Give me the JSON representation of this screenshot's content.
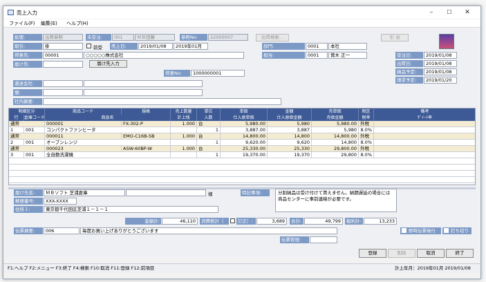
{
  "window": {
    "title": "売上入力",
    "minimize": "–",
    "maximize": "☐",
    "close": "✕"
  },
  "menu": [
    "ファイル(F)",
    "編集(E)",
    "ヘルプ(H)"
  ],
  "header": {
    "shori_label": "処理:",
    "shori_value": "出荷参照",
    "juchu_label": "未受注:",
    "juchu_code": "001",
    "juchu_name": "ＭＢ田藤",
    "sansho_label": "参照No:",
    "sansho_value": "22000007",
    "sansho_btn": "出荷検索...",
    "hikiate_btn": "引 当",
    "torihiki_label": "取引:",
    "torihiki_value": "掛",
    "zenuke_label": "前受",
    "uriage_label": "売上日:",
    "uriage_date": "2019/01/08",
    "uriage_month": "2019年01月",
    "bumon_label": "部門:",
    "bumon_code": "0001",
    "bumon_name": "本社",
    "tokui_label": "得意先:",
    "tokui_code": "00001",
    "tokui_name": "○○○○○株式会社",
    "tanto_label": "担当:",
    "tanto_code": "0001",
    "tanto_name": "賞木 正一",
    "todoke_label": "届け先:",
    "todoke_btn": "届け先入力",
    "denpyo_label": "得意No:",
    "denpyo_value": "1000000001",
    "unso_label": "運送会社:",
    "bin_label": "便:",
    "shanai_label": "社内摘要:",
    "dates": [
      {
        "label": "受注日:",
        "value": "2019/01/08"
      },
      {
        "label": "出荷日:",
        "value": "2019/01/08"
      },
      {
        "label": "納品予定:",
        "value": "2019/01/08"
      },
      {
        "label": "請求予定:",
        "value": "2019/01/20"
      }
    ]
  },
  "grid": {
    "head1": [
      "明細区分",
      "商品コード",
      "規格",
      "売上数量",
      "単位",
      "単価",
      "金額",
      "売単価",
      "税区",
      "備考"
    ],
    "head2": [
      "行",
      "倉庫コード",
      "商品名",
      "計上残",
      "入数",
      "仕入原単価",
      "仕入原価金額",
      "売価金額",
      "税率",
      "ｻﾞｲｰﾄ率"
    ],
    "rows": [
      {
        "a": [
          "通常",
          "000001",
          "FX-302-P",
          "1.000",
          "台",
          "5,980.00",
          "5,980",
          "5,980.00",
          "外税",
          ""
        ],
        "b": [
          "1",
          "001",
          "コンパクトファンヒータ",
          "",
          "1",
          "3,887.00",
          "3,887",
          "5,980",
          "8.0%",
          ""
        ]
      },
      {
        "a": [
          "通常",
          "000011",
          "EMO-C16B-SB",
          "1.000",
          "台",
          "14,800.00",
          "14,800",
          "14,800.00",
          "外税",
          ""
        ],
        "b": [
          "2",
          "001",
          "オーブンレンジ",
          "",
          "1",
          "9,620.00",
          "9,620",
          "14,800",
          "8.0%",
          ""
        ]
      },
      {
        "a": [
          "通常",
          "000023",
          "ASW-60BP-W",
          "1.000",
          "台",
          "25,330.00",
          "25,330",
          "29,800.00",
          "外税",
          ""
        ],
        "b": [
          "3",
          "001",
          "全自動洗濯機",
          "",
          "1",
          "19,370.00",
          "19,370",
          "29,800",
          "8.0%",
          ""
        ]
      }
    ]
  },
  "delivery": {
    "name_label": "届け先名:",
    "name_value": "ＭＢソフト 芝浦倉庫",
    "sama": "様",
    "zip_label": "郵便番号:",
    "zip_value": "XXX-XXXX",
    "addr_label": "住所１:",
    "addr_value": "東京都千代田区芝浦１－１－１",
    "note_label": "特記事項:",
    "note_value": "分割納品は受け付けて貰えません。納期遅延の場合には商品センターに事前連絡が必要です。"
  },
  "totals": {
    "kingaku_label": "金額計:",
    "kingaku": "46,110",
    "tax_label": "消費税計（",
    "tax_mark": "□",
    "tax_suffix": "訂正）:",
    "tax": "3,689",
    "gokei_label": "合計:",
    "gokei": "49,799",
    "arari_label": "粗利計:",
    "arari": "13,233"
  },
  "footer": {
    "tekiyo_label": "伝票摘要:",
    "tekiyo_code": "006",
    "tekiyo_text": "毎度お買い上げありがとうございます",
    "hoko_label": "即時伝票発行",
    "uchikiri_label": "打ち切り",
    "kanri_label": "伝票管理:"
  },
  "buttons": {
    "toroku": "登録",
    "sakujo": "削除",
    "torikeshi": "取消",
    "shuryo": "終了"
  },
  "status": {
    "keys": "F1:ヘルプ F2:メニュー F3:終了 F4:検索 F10:取消 F11:登録 F12:前項目",
    "right": "計上年月：2019年01月 2019/01/08"
  },
  "colors": {
    "label_bg": "#7d9ac6",
    "grid_header": "#3d5a96",
    "row_alt": "#f4ecd2"
  }
}
